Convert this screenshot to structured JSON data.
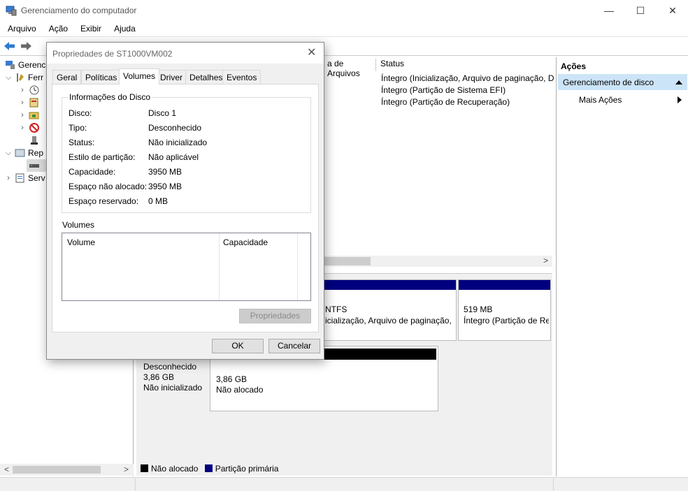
{
  "window": {
    "title": "Gerenciamento do computador",
    "min": "—",
    "max": "☐",
    "close": "✕"
  },
  "menu": [
    "Arquivo",
    "Ação",
    "Exibir",
    "Ajuda"
  ],
  "tree": {
    "items": [
      {
        "label": "Gerenci"
      },
      {
        "label": "Ferr"
      },
      {
        "label": "Rep"
      },
      {
        "label": "Serv"
      }
    ],
    "scroll_left": "<",
    "scroll_right": ">"
  },
  "list": {
    "col_filesystem": "a de Arquivos",
    "col_status": "Status",
    "status_rows": [
      "Íntegro (Inicialização, Arquivo de paginação, D",
      "Íntegro (Partição de Sistema EFI)",
      "Íntegro (Partição de Recuperação)"
    ],
    "scroll_right": ">"
  },
  "disk_map": {
    "disk0_part1_line1": "NTFS",
    "disk0_part1_line2": "icialização, Arquivo de paginação, D",
    "disk0_part2_line1": "519 MB",
    "disk0_part2_line2": "Íntegro (Partição de Re",
    "disk1_type": "Desconhecido",
    "disk1_size": "3,86 GB",
    "disk1_state": "Não inicializado",
    "disk1_part_size": "3,86 GB",
    "disk1_part_state": "Não alocado",
    "legend_unallocated": "Não alocado",
    "legend_primary": "Partição primária"
  },
  "actions": {
    "header": "Ações",
    "section": "Gerenciamento de disco",
    "more": "Mais Ações"
  },
  "dialog": {
    "title": "Propriedades de ST1000VM002",
    "close": "✕",
    "tabs": [
      "Geral",
      "Políticas",
      "Volumes",
      "Driver",
      "Detalhes",
      "Eventos"
    ],
    "active_tab": "Volumes",
    "group_title": "Informações do Disco",
    "fields": [
      {
        "label": "Disco:",
        "value": "Disco 1"
      },
      {
        "label": "Tipo:",
        "value": "Desconhecido"
      },
      {
        "label": "Status:",
        "value": "Não inicializado"
      },
      {
        "label": "Estilo de partição:",
        "value": "Não aplicável"
      },
      {
        "label": "Capacidade:",
        "value": "3950 MB"
      },
      {
        "label": "Espaço não alocado:",
        "value": "3950 MB"
      },
      {
        "label": "Espaço reservado:",
        "value": "0 MB"
      }
    ],
    "volumes_label": "Volumes",
    "volumes_columns": [
      "Volume",
      "Capacidade"
    ],
    "properties_button": "Propriedades",
    "ok": "OK",
    "cancel": "Cancelar"
  },
  "colors": {
    "primary_partition": "#00007f",
    "unallocated": "#000000",
    "actions_highlight": "#cce4f7"
  }
}
